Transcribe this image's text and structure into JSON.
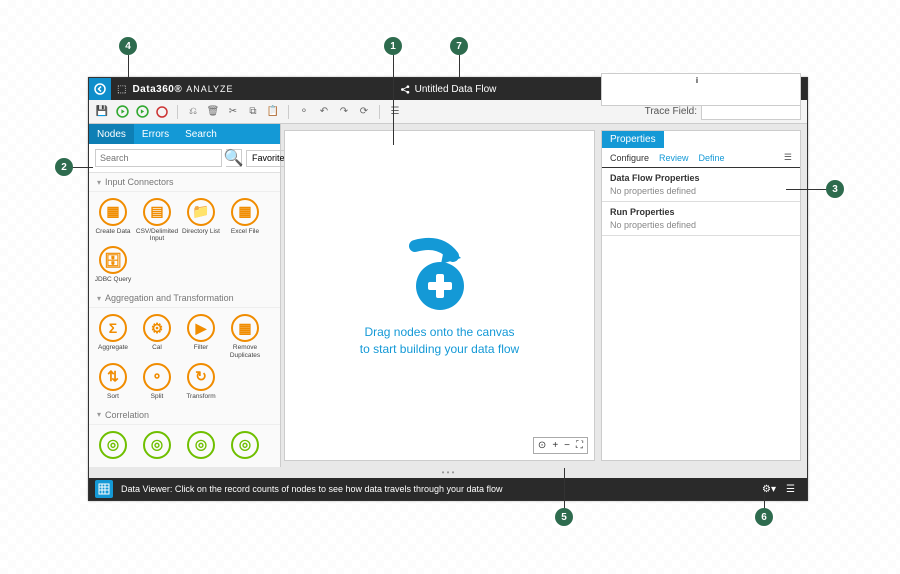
{
  "titlebar": {
    "brand": "Data360®",
    "analyze": "ANALYZE",
    "flow_title": "Untitled Data Flow"
  },
  "toolbar": {
    "trace_label": "Trace Field:",
    "trace_value": ""
  },
  "left_tabs": {
    "nodes": "Nodes",
    "errors": "Errors",
    "search": "Search"
  },
  "search": {
    "placeholder": "Search",
    "fav": "Favorites"
  },
  "categories": [
    {
      "name": "Input Connectors",
      "color": "orange",
      "nodes": [
        {
          "label": "Create Data",
          "glyph": "▦"
        },
        {
          "label": "CSV/Delimited Input",
          "glyph": "▤"
        },
        {
          "label": "Directory List",
          "glyph": "📁"
        },
        {
          "label": "Excel File",
          "glyph": "▦"
        },
        {
          "label": "JDBC Query",
          "glyph": "🗄"
        }
      ]
    },
    {
      "name": "Aggregation and Transformation",
      "color": "orange",
      "nodes": [
        {
          "label": "Aggregate",
          "glyph": "Σ"
        },
        {
          "label": "Cal",
          "glyph": "⚙"
        },
        {
          "label": "Filter",
          "glyph": "▶"
        },
        {
          "label": "Remove Duplicates",
          "glyph": "▦"
        },
        {
          "label": "Sort",
          "glyph": "⇅"
        },
        {
          "label": "Split",
          "glyph": "⚬"
        },
        {
          "label": "Transform",
          "glyph": "↻"
        }
      ]
    },
    {
      "name": "Correlation",
      "color": "green",
      "nodes": [
        {
          "label": "",
          "glyph": "◎"
        },
        {
          "label": "",
          "glyph": "◎"
        },
        {
          "label": "",
          "glyph": "◎"
        },
        {
          "label": "",
          "glyph": "◎"
        }
      ]
    }
  ],
  "canvas": {
    "hint1": "Drag nodes onto the canvas",
    "hint2": "to start building your data flow"
  },
  "props": {
    "tab": "Properties",
    "subtabs": {
      "configure": "Configure",
      "review": "Review",
      "define": "Define"
    },
    "sec1_head": "Data Flow Properties",
    "sec1_body": "No properties defined",
    "sec2_head": "Run Properties",
    "sec2_body": "No properties defined"
  },
  "footer": {
    "text": "Data Viewer: Click on the record counts of nodes to see how data travels through your data flow"
  },
  "callouts": [
    "1",
    "2",
    "3",
    "4",
    "5",
    "6",
    "7"
  ]
}
